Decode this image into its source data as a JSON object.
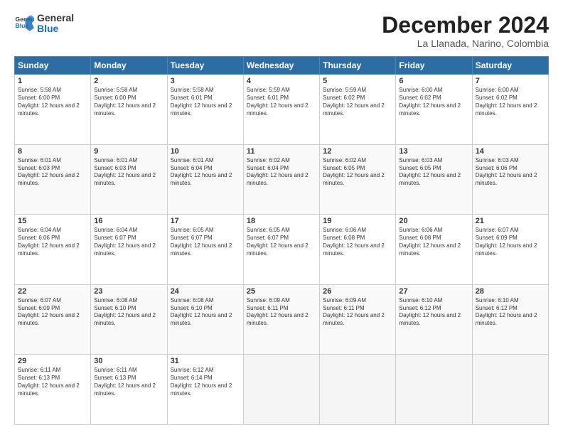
{
  "header": {
    "logo_line1": "General",
    "logo_line2": "Blue",
    "month": "December 2024",
    "location": "La Llanada, Narino, Colombia"
  },
  "weekdays": [
    "Sunday",
    "Monday",
    "Tuesday",
    "Wednesday",
    "Thursday",
    "Friday",
    "Saturday"
  ],
  "weeks": [
    [
      {
        "day": "1",
        "sunrise": "5:58 AM",
        "sunset": "6:00 PM",
        "daylight": "12 hours and 2 minutes."
      },
      {
        "day": "2",
        "sunrise": "5:58 AM",
        "sunset": "6:00 PM",
        "daylight": "12 hours and 2 minutes."
      },
      {
        "day": "3",
        "sunrise": "5:58 AM",
        "sunset": "6:01 PM",
        "daylight": "12 hours and 2 minutes."
      },
      {
        "day": "4",
        "sunrise": "5:59 AM",
        "sunset": "6:01 PM",
        "daylight": "12 hours and 2 minutes."
      },
      {
        "day": "5",
        "sunrise": "5:59 AM",
        "sunset": "6:02 PM",
        "daylight": "12 hours and 2 minutes."
      },
      {
        "day": "6",
        "sunrise": "6:00 AM",
        "sunset": "6:02 PM",
        "daylight": "12 hours and 2 minutes."
      },
      {
        "day": "7",
        "sunrise": "6:00 AM",
        "sunset": "6:02 PM",
        "daylight": "12 hours and 2 minutes."
      }
    ],
    [
      {
        "day": "8",
        "sunrise": "6:01 AM",
        "sunset": "6:03 PM",
        "daylight": "12 hours and 2 minutes."
      },
      {
        "day": "9",
        "sunrise": "6:01 AM",
        "sunset": "6:03 PM",
        "daylight": "12 hours and 2 minutes."
      },
      {
        "day": "10",
        "sunrise": "6:01 AM",
        "sunset": "6:04 PM",
        "daylight": "12 hours and 2 minutes."
      },
      {
        "day": "11",
        "sunrise": "6:02 AM",
        "sunset": "6:04 PM",
        "daylight": "12 hours and 2 minutes."
      },
      {
        "day": "12",
        "sunrise": "6:02 AM",
        "sunset": "6:05 PM",
        "daylight": "12 hours and 2 minutes."
      },
      {
        "day": "13",
        "sunrise": "6:03 AM",
        "sunset": "6:05 PM",
        "daylight": "12 hours and 2 minutes."
      },
      {
        "day": "14",
        "sunrise": "6:03 AM",
        "sunset": "6:06 PM",
        "daylight": "12 hours and 2 minutes."
      }
    ],
    [
      {
        "day": "15",
        "sunrise": "6:04 AM",
        "sunset": "6:06 PM",
        "daylight": "12 hours and 2 minutes."
      },
      {
        "day": "16",
        "sunrise": "6:04 AM",
        "sunset": "6:07 PM",
        "daylight": "12 hours and 2 minutes."
      },
      {
        "day": "17",
        "sunrise": "6:05 AM",
        "sunset": "6:07 PM",
        "daylight": "12 hours and 2 minutes."
      },
      {
        "day": "18",
        "sunrise": "6:05 AM",
        "sunset": "6:07 PM",
        "daylight": "12 hours and 2 minutes."
      },
      {
        "day": "19",
        "sunrise": "6:06 AM",
        "sunset": "6:08 PM",
        "daylight": "12 hours and 2 minutes."
      },
      {
        "day": "20",
        "sunrise": "6:06 AM",
        "sunset": "6:08 PM",
        "daylight": "12 hours and 2 minutes."
      },
      {
        "day": "21",
        "sunrise": "6:07 AM",
        "sunset": "6:09 PM",
        "daylight": "12 hours and 2 minutes."
      }
    ],
    [
      {
        "day": "22",
        "sunrise": "6:07 AM",
        "sunset": "6:09 PM",
        "daylight": "12 hours and 2 minutes."
      },
      {
        "day": "23",
        "sunrise": "6:08 AM",
        "sunset": "6:10 PM",
        "daylight": "12 hours and 2 minutes."
      },
      {
        "day": "24",
        "sunrise": "6:08 AM",
        "sunset": "6:10 PM",
        "daylight": "12 hours and 2 minutes."
      },
      {
        "day": "25",
        "sunrise": "6:09 AM",
        "sunset": "6:11 PM",
        "daylight": "12 hours and 2 minutes."
      },
      {
        "day": "26",
        "sunrise": "6:09 AM",
        "sunset": "6:11 PM",
        "daylight": "12 hours and 2 minutes."
      },
      {
        "day": "27",
        "sunrise": "6:10 AM",
        "sunset": "6:12 PM",
        "daylight": "12 hours and 2 minutes."
      },
      {
        "day": "28",
        "sunrise": "6:10 AM",
        "sunset": "6:12 PM",
        "daylight": "12 hours and 2 minutes."
      }
    ],
    [
      {
        "day": "29",
        "sunrise": "6:11 AM",
        "sunset": "6:13 PM",
        "daylight": "12 hours and 2 minutes."
      },
      {
        "day": "30",
        "sunrise": "6:11 AM",
        "sunset": "6:13 PM",
        "daylight": "12 hours and 2 minutes."
      },
      {
        "day": "31",
        "sunrise": "6:12 AM",
        "sunset": "6:14 PM",
        "daylight": "12 hours and 2 minutes."
      },
      null,
      null,
      null,
      null
    ]
  ]
}
